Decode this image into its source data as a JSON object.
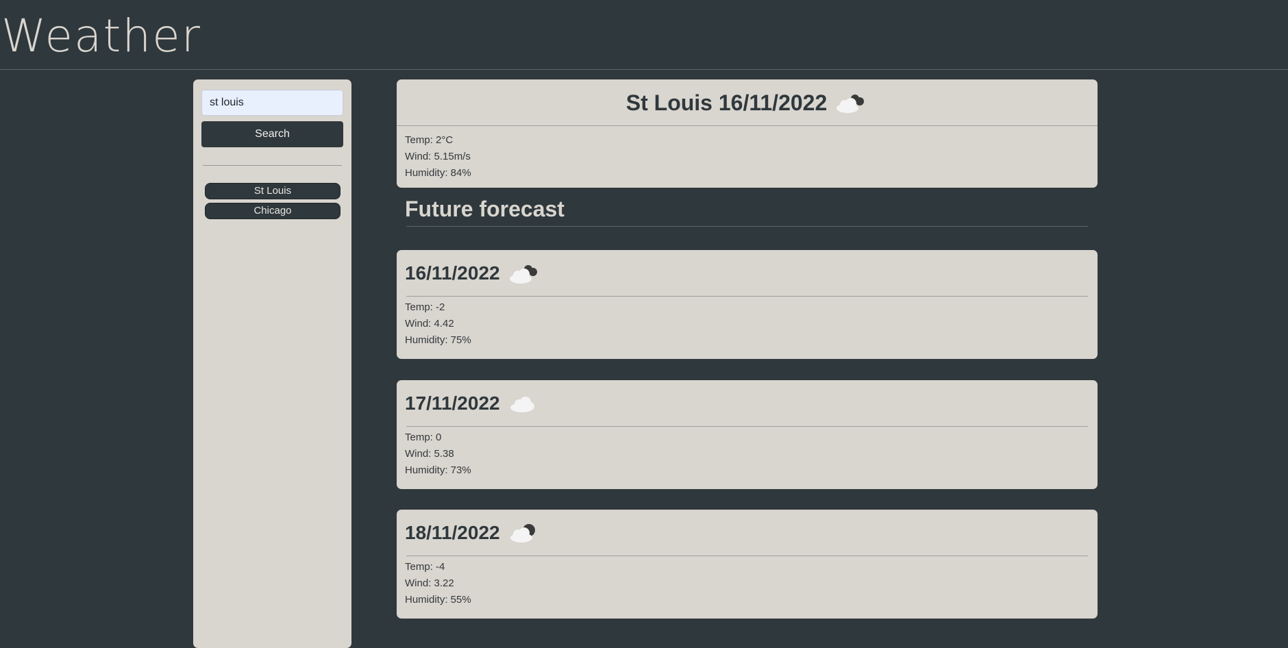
{
  "header": {
    "title": "Weather"
  },
  "sidebar": {
    "search_value": "st louis",
    "search_button": "Search",
    "history": [
      {
        "label": "St Louis"
      },
      {
        "label": "Chicago"
      }
    ]
  },
  "current": {
    "title": "St Louis 16/11/2022",
    "icon": "broken-clouds-icon",
    "temp": "Temp: 2°C",
    "wind": "Wind: 5.15m/s",
    "humidity": "Humidity: 84%"
  },
  "forecast_heading": "Future forecast",
  "forecast": [
    {
      "date": "16/11/2022",
      "icon": "broken-clouds-icon",
      "temp": "Temp: -2",
      "wind": "Wind: 4.42",
      "humidity": "Humidity: 75%"
    },
    {
      "date": "17/11/2022",
      "icon": "cloud-icon",
      "temp": "Temp: 0",
      "wind": "Wind: 5.38",
      "humidity": "Humidity: 73%"
    },
    {
      "date": "18/11/2022",
      "icon": "cloud-night-icon",
      "temp": "Temp: -4",
      "wind": "Wind: 3.22",
      "humidity": "Humidity: 55%"
    }
  ],
  "colors": {
    "background": "#2f383c",
    "card": "#d9d5cf",
    "input": "#e8f0fe"
  }
}
